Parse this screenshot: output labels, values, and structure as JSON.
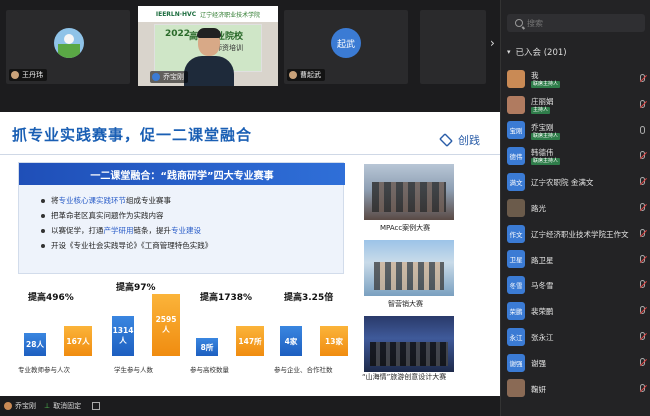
{
  "video_strip": {
    "tiles": [
      {
        "name": "王丹玮",
        "initial": ""
      },
      {
        "name": "乔宝刚",
        "initial": ""
      },
      {
        "name": "曹起武",
        "initial": "起武"
      }
    ],
    "speaker_banner": {
      "logo_text": "IEERLN·HVC",
      "school_text": "辽宁经济职业技术学院"
    },
    "speaker_board": {
      "line1": "2022",
      "line2": "高等职业院校",
      "line3": "师资培训"
    }
  },
  "slide": {
    "title": "抓专业实践赛事，促一二课堂融合",
    "logo": "创践",
    "info_header": "一二课堂融合：“践商研学”四大专业赛事",
    "bullets": [
      {
        "pre": "将",
        "hl": "专业核心课实践环节",
        "post": "组成专业赛事"
      },
      {
        "pre": "把革命老区真实问题作为实践内容",
        "hl": "",
        "post": ""
      },
      {
        "pre": "以赛促学，打通",
        "hl": "产学研用",
        "post": "链条，提升",
        "hl2": "专业建设"
      },
      {
        "pre": "开设《专业社会实践导论》《工商管理特色实践》",
        "hl": "",
        "post": ""
      }
    ],
    "stats": [
      {
        "label": "提高496%",
        "before": "28人",
        "after": "167人",
        "caption": "专业教师参与人次",
        "before_v": 28,
        "after_v": 167
      },
      {
        "label": "提高97%",
        "before": "1314人",
        "after": "2595人",
        "caption": "学生参与人数",
        "before_v": 1314,
        "after_v": 2595
      },
      {
        "label": "提高1738%",
        "before": "8所",
        "after": "147所",
        "caption": "参与高校数量",
        "before_v": 8,
        "after_v": 147
      },
      {
        "label": "提高3.25倍",
        "before": "4家",
        "after": "13家",
        "caption": "参与企业、合作社数",
        "before_v": 4,
        "after_v": 13
      }
    ],
    "photos": [
      {
        "caption": "MPAcc案例大赛"
      },
      {
        "caption": "智营销大赛"
      },
      {
        "caption": "“山海情”旅游创意设计大赛"
      }
    ]
  },
  "bottom_bar": {
    "presenter": "乔宝刚",
    "unpin_label": "取消固定"
  },
  "panel": {
    "search_placeholder": "搜索",
    "group_label": "已入会 (201)",
    "members": [
      {
        "avatar": "",
        "name": "我",
        "tag": "联席主持人",
        "color": "#c98a55"
      },
      {
        "avatar": "",
        "name": "庄丽娟",
        "tag": "主持人",
        "color": "#b07b60"
      },
      {
        "avatar": "宝刚",
        "name": "乔宝刚",
        "tag": "联席主持人",
        "color": "#3b7bd4"
      },
      {
        "avatar": "德伟",
        "name": "韩德伟",
        "tag": "联席主持人",
        "color": "#3b7bd4"
      },
      {
        "avatar": "满文",
        "name": "辽宁农职院 金满文",
        "tag": "",
        "color": "#3b7bd4"
      },
      {
        "avatar": "",
        "name": "路光",
        "tag": "",
        "color": "#6b5b4b"
      },
      {
        "avatar": "作文",
        "name": "辽宁经济职业技术学院王作文",
        "tag": "",
        "color": "#3b7bd4"
      },
      {
        "avatar": "卫星",
        "name": "路卫星",
        "tag": "",
        "color": "#3b7bd4"
      },
      {
        "avatar": "冬雪",
        "name": "马冬雪",
        "tag": "",
        "color": "#3b7bd4"
      },
      {
        "avatar": "荣鹏",
        "name": "裴荣鹏",
        "tag": "",
        "color": "#3b7bd4"
      },
      {
        "avatar": "永江",
        "name": "张永江",
        "tag": "",
        "color": "#3b7bd4"
      },
      {
        "avatar": "谢强",
        "name": "谢强",
        "tag": "",
        "color": "#3b7bd4"
      },
      {
        "avatar": "",
        "name": "鞠妍",
        "tag": "",
        "color": "#8a6a55"
      }
    ]
  },
  "colors": {
    "accent": "#1a5fb4",
    "orange": "#f08c10",
    "panel_bg": "#232325",
    "host_tag": "#2f7d4a"
  }
}
